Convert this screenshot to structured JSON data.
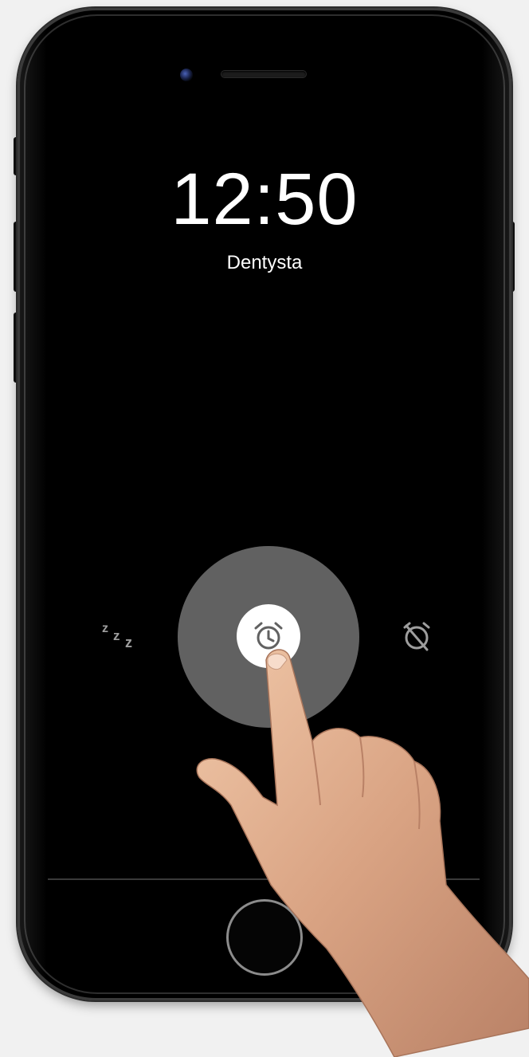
{
  "alarm": {
    "time": "12:50",
    "label": "Dentysta"
  },
  "actions": {
    "snooze_icon": "snooze-zzz-icon",
    "alarm_icon": "alarm-clock-icon",
    "dismiss_icon": "alarm-off-icon",
    "snooze_glyph_1": "z",
    "snooze_glyph_2": "z",
    "snooze_glyph_3": "z"
  },
  "colors": {
    "screen": "#000000",
    "ripple": "#616161",
    "icon_gray": "#9e9e9e",
    "text": "#ffffff"
  }
}
